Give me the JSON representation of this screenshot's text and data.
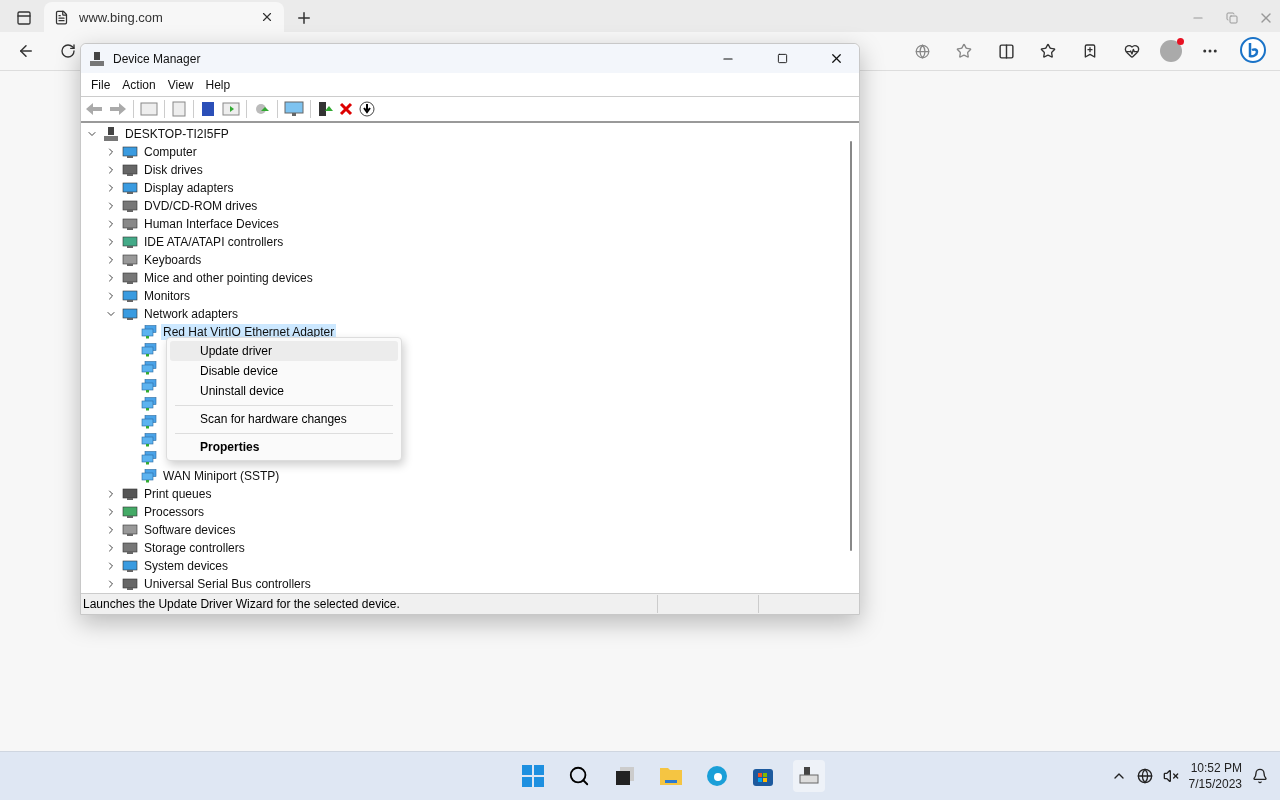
{
  "browser": {
    "tab": {
      "title": "www.bing.com",
      "selected": true
    }
  },
  "window": {
    "title": "Device Manager"
  },
  "menu_bar": [
    "File",
    "Action",
    "View",
    "Help"
  ],
  "tree": {
    "label": "DESKTOP-TI2I5FP",
    "expanded": true,
    "children": [
      {
        "label": "Computer",
        "expanded": false
      },
      {
        "label": "Disk drives",
        "expanded": false
      },
      {
        "label": "Display adapters",
        "expanded": false
      },
      {
        "label": "DVD/CD-ROM drives",
        "expanded": false
      },
      {
        "label": "Human Interface Devices",
        "expanded": false
      },
      {
        "label": "IDE ATA/ATAPI controllers",
        "expanded": false
      },
      {
        "label": "Keyboards",
        "expanded": false
      },
      {
        "label": "Mice and other pointing devices",
        "expanded": false
      },
      {
        "label": "Monitors",
        "expanded": false
      },
      {
        "label": "Network adapters",
        "expanded": true,
        "children": [
          {
            "kind": "labeled",
            "label": "Red Hat VirtIO Ethernet Adapter",
            "selected": true
          },
          {
            "kind": "icon_only"
          },
          {
            "kind": "icon_only"
          },
          {
            "kind": "icon_only"
          },
          {
            "kind": "icon_only"
          },
          {
            "kind": "icon_only"
          },
          {
            "kind": "icon_only"
          },
          {
            "kind": "icon_only"
          },
          {
            "kind": "labeled",
            "label": "WAN Miniport (SSTP)",
            "selected": false
          }
        ]
      },
      {
        "label": "Print queues",
        "expanded": false
      },
      {
        "label": "Processors",
        "expanded": false
      },
      {
        "label": "Software devices",
        "expanded": false
      },
      {
        "label": "Storage controllers",
        "expanded": false
      },
      {
        "label": "System devices",
        "expanded": false
      },
      {
        "label": "Universal Serial Bus controllers",
        "expanded": false
      }
    ]
  },
  "context_menu": [
    {
      "kind": "item",
      "label": "Update driver",
      "selected": true
    },
    {
      "kind": "item",
      "label": "Disable device",
      "selected": false
    },
    {
      "kind": "item",
      "label": "Uninstall device",
      "selected": false
    },
    {
      "kind": "separator"
    },
    {
      "kind": "item",
      "label": "Scan for hardware changes",
      "selected": false
    },
    {
      "kind": "separator"
    },
    {
      "kind": "default",
      "label": "Properties",
      "selected": false
    }
  ],
  "status_bar": "Launches the Update Driver Wizard for the selected device.",
  "taskbar": {
    "time": "10:52 PM",
    "date": "7/15/2023"
  }
}
